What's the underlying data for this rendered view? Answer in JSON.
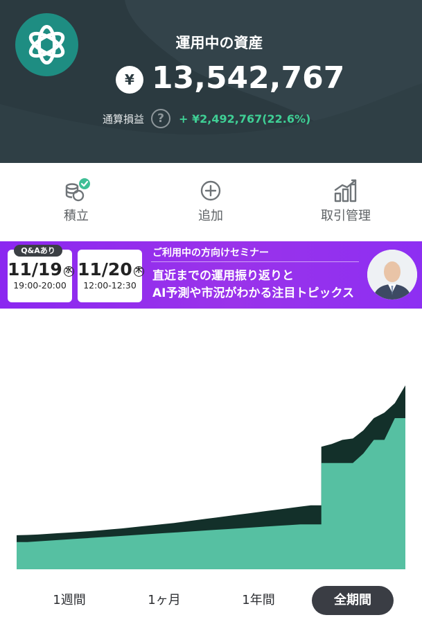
{
  "header": {
    "title": "運用中の資産",
    "currency_symbol": "¥",
    "amount": "13,542,767",
    "pl_label": "通算損益",
    "help_symbol": "?",
    "pl_value": "+ ¥2,492,767(22.6%)",
    "pl_color": "#3fcf95",
    "logo_icon": "orbit-logo-icon"
  },
  "actions": [
    {
      "label": "積立",
      "icon": "coins-check-icon"
    },
    {
      "label": "追加",
      "icon": "plus-circle-icon"
    },
    {
      "label": "取引管理",
      "icon": "bar-chart-icon"
    }
  ],
  "banner": {
    "qa_tag": "Q&Aあり",
    "dates": [
      {
        "date": "11/19",
        "dow": "水",
        "time": "19:00-20:00"
      },
      {
        "date": "11/20",
        "dow": "木",
        "time": "12:00-12:30"
      }
    ],
    "subtitle": "ご利用中の方向けセミナー",
    "title_line1": "直近までの運用振り返りと",
    "title_line2": "AI予測や市況がわかる注目トピックス",
    "speaker_image": "speaker-portrait"
  },
  "chart_data": {
    "type": "area",
    "series": [
      {
        "role": "asset-value",
        "color": "#13302a",
        "values": [
          2.5,
          2.52,
          2.55,
          2.6,
          2.65,
          2.7,
          2.75,
          2.8,
          2.86,
          2.93,
          3.0,
          3.08,
          3.16,
          3.24,
          3.32,
          3.4,
          3.5,
          3.6,
          3.7,
          3.8,
          3.9,
          4.0,
          4.1,
          4.2,
          4.3,
          4.4,
          4.5,
          4.6,
          4.7,
          9.0,
          9.2,
          9.5,
          9.6,
          10.2,
          11.1,
          11.5,
          12.2,
          13.5
        ]
      },
      {
        "role": "principal",
        "color": "#56c0a2",
        "values": [
          2.0,
          2.0,
          2.05,
          2.1,
          2.15,
          2.2,
          2.25,
          2.3,
          2.35,
          2.4,
          2.45,
          2.5,
          2.55,
          2.6,
          2.65,
          2.7,
          2.75,
          2.8,
          2.85,
          2.9,
          2.95,
          3.0,
          3.05,
          3.1,
          3.15,
          3.2,
          3.25,
          3.3,
          3.3,
          7.8,
          7.8,
          7.8,
          7.8,
          8.5,
          9.5,
          9.5,
          11.1,
          11.1
        ]
      }
    ],
    "ylim": [
      0,
      14
    ],
    "grid": false
  },
  "periods": {
    "items": [
      "1週間",
      "1ヶ月",
      "1年間",
      "全期間"
    ],
    "active": "全期間"
  }
}
